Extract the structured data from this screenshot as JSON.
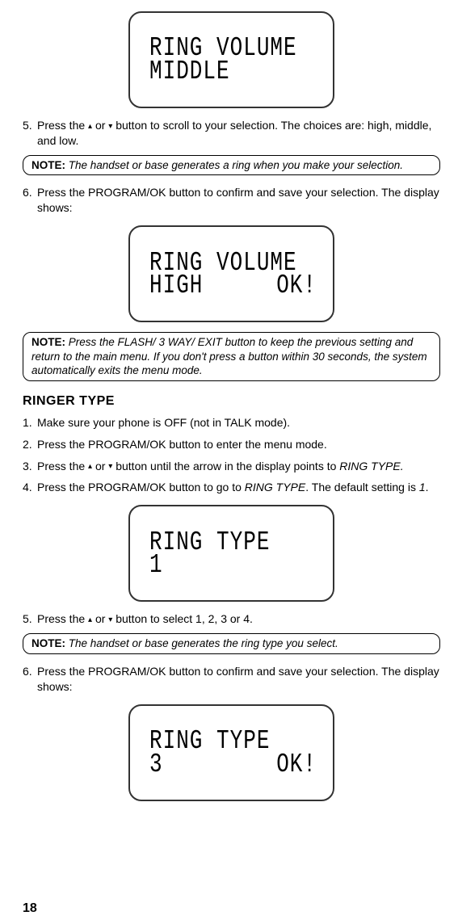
{
  "lcd1": {
    "line1": "RING VOLUME",
    "line2": "MIDDLE"
  },
  "step5a": {
    "num": "5.",
    "text_before": "Press the ",
    "up": "▴",
    "mid": " or ",
    "down": "▾",
    "text_after": " button to scroll to your selection. The choices are: high, middle, and low."
  },
  "note1": {
    "label": "NOTE:",
    "text": " The handset or base generates a ring when you make your selection."
  },
  "step6a": {
    "num": "6.",
    "text": "Press the PROGRAM/OK button to confirm and save your selection. The display shows:"
  },
  "lcd2": {
    "line1": "RING VOLUME",
    "line2_left": "HIGH",
    "line2_right": "OK!"
  },
  "note2": {
    "label": "NOTE:",
    "text": " Press the FLASH/ 3 WAY/ EXIT button to keep the previous setting and return to the main menu. If you don't press a button within 30 seconds, the system automatically exits the menu mode."
  },
  "heading": "RINGER TYPE",
  "step1b": {
    "num": "1.",
    "text": "Make sure your phone is OFF (not in TALK mode)."
  },
  "step2b": {
    "num": "2.",
    "text": "Press the PROGRAM/OK button to enter the menu mode."
  },
  "step3b": {
    "num": "3.",
    "text_before": "Press the ",
    "up": "▴",
    "mid": " or ",
    "down": "▾",
    "text_after": " button until the arrow in the display points to ",
    "ital": "RING TYPE."
  },
  "step4b": {
    "num": "4.",
    "text_before": "Press the PROGRAM/OK button to go to ",
    "ital1": "RING TYPE",
    "mid": ". The default setting is ",
    "ital2": "1",
    "after": "."
  },
  "lcd3": {
    "line1": "RING TYPE",
    "line2": "1"
  },
  "step5b": {
    "num": "5.",
    "text_before": "Press the ",
    "up": "▴",
    "mid": " or ",
    "down": "▾",
    "text_after": " button to select 1, 2, 3 or 4."
  },
  "note3": {
    "label": "NOTE:",
    "text": " The handset or base generates the ring type you select."
  },
  "step6b": {
    "num": "6.",
    "text": "Press the PROGRAM/OK button to confirm and save your selection. The display shows:"
  },
  "lcd4": {
    "line1": "RING TYPE",
    "line2_left": "3",
    "line2_right": "OK!"
  },
  "page": "18"
}
